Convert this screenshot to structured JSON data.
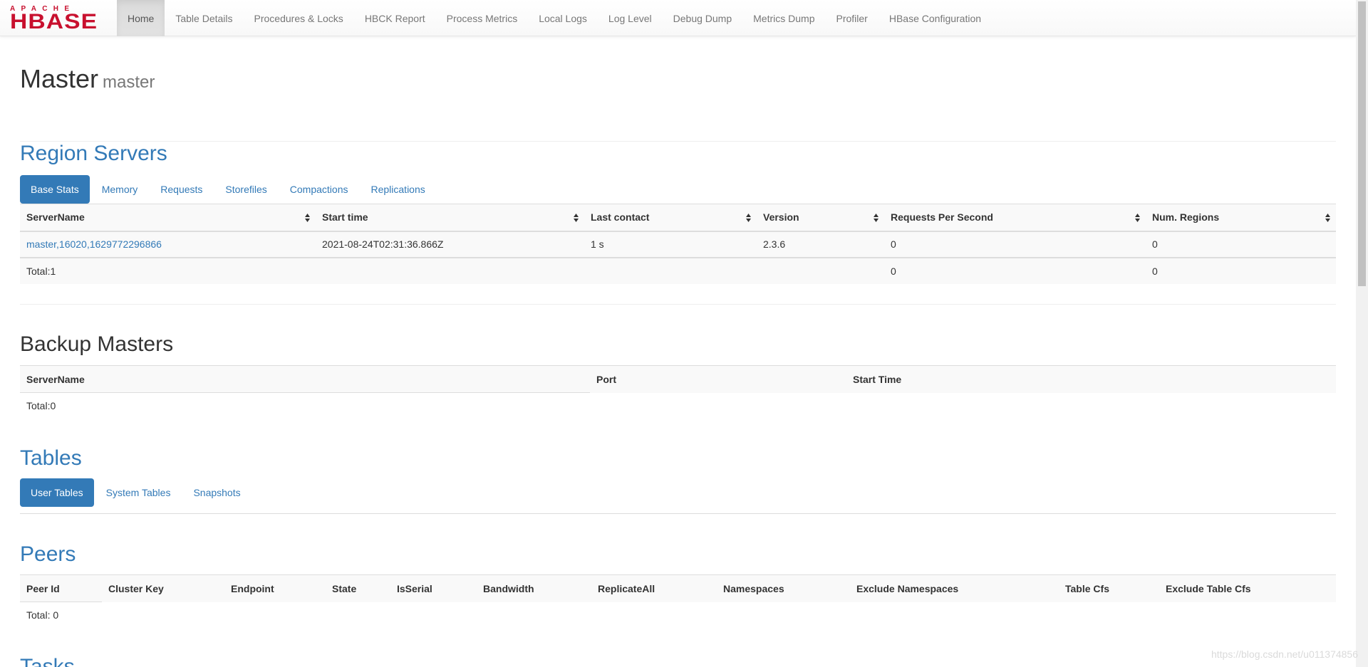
{
  "brand": {
    "top": "APACHE",
    "bottom": "HBASE"
  },
  "nav": [
    "Home",
    "Table Details",
    "Procedures & Locks",
    "HBCK Report",
    "Process Metrics",
    "Local Logs",
    "Log Level",
    "Debug Dump",
    "Metrics Dump",
    "Profiler",
    "HBase Configuration"
  ],
  "header": {
    "title": "Master",
    "subtitle": "master"
  },
  "region_servers": {
    "title": "Region Servers",
    "tabs": [
      "Base Stats",
      "Memory",
      "Requests",
      "Storefiles",
      "Compactions",
      "Replications"
    ],
    "columns": [
      "ServerName",
      "Start time",
      "Last contact",
      "Version",
      "Requests Per Second",
      "Num. Regions"
    ],
    "rows": [
      [
        "master,16020,1629772296866",
        "2021-08-24T02:31:36.866Z",
        "1 s",
        "2.3.6",
        "0",
        "0"
      ]
    ],
    "total": [
      "Total:1",
      "",
      "",
      "",
      "0",
      "0"
    ]
  },
  "backup_masters": {
    "title": "Backup Masters",
    "columns": [
      "ServerName",
      "Port",
      "Start Time"
    ],
    "total": "Total:0"
  },
  "tables": {
    "title": "Tables",
    "tabs": [
      "User Tables",
      "System Tables",
      "Snapshots"
    ]
  },
  "peers": {
    "title": "Peers",
    "columns": [
      "Peer Id",
      "Cluster Key",
      "Endpoint",
      "State",
      "IsSerial",
      "Bandwidth",
      "ReplicateAll",
      "Namespaces",
      "Exclude Namespaces",
      "Table Cfs",
      "Exclude Table Cfs"
    ],
    "total": "Total: 0"
  },
  "tasks": {
    "title": "Tasks"
  },
  "watermark": "https://blog.csdn.net/u011374856"
}
